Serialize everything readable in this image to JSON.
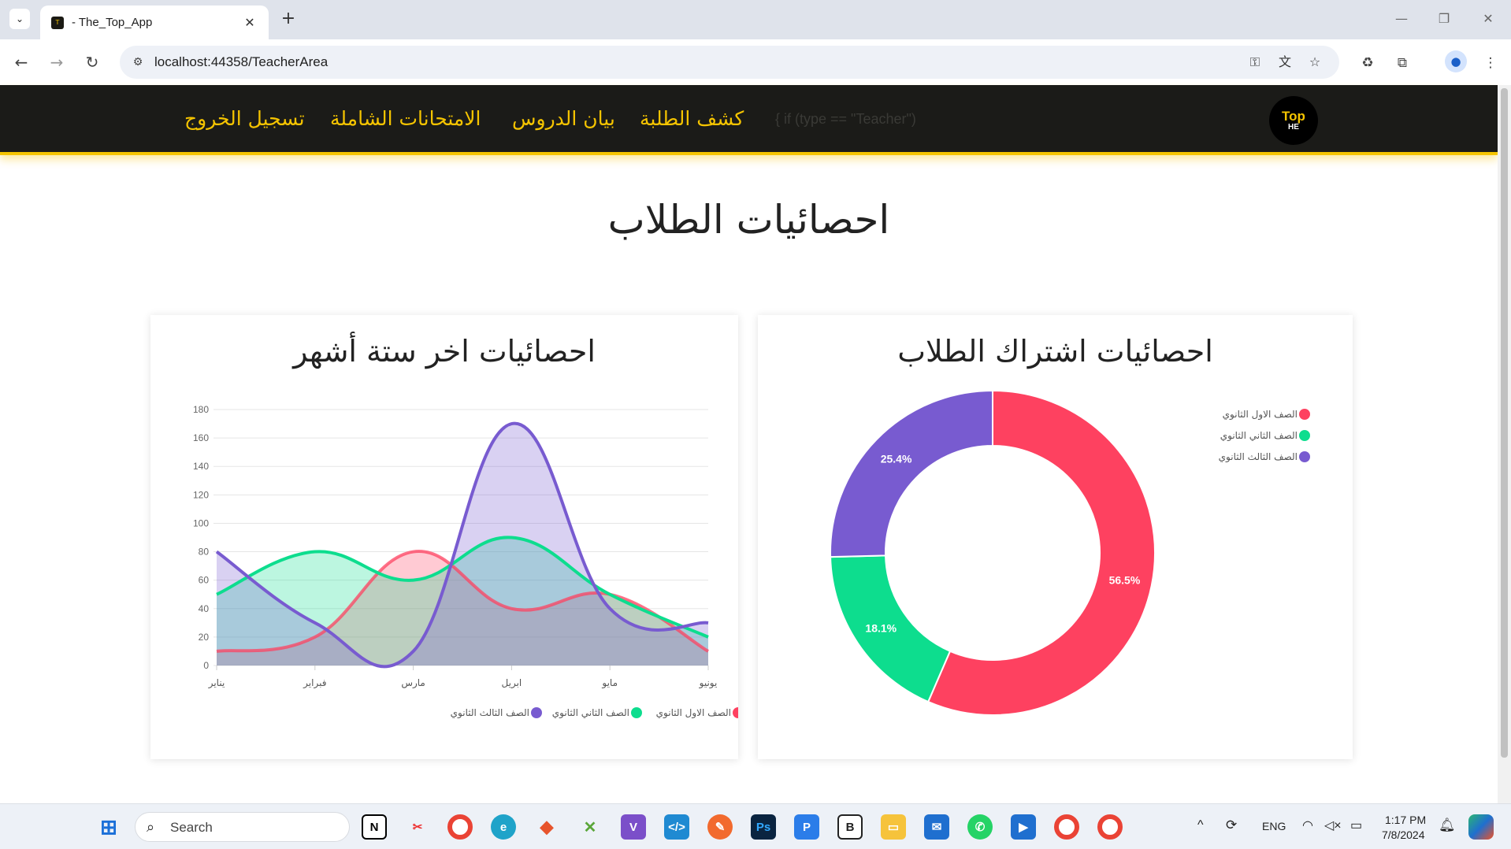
{
  "browser": {
    "tab_title": "- The_Top_App",
    "url": "localhost:44358/TeacherArea"
  },
  "site": {
    "nav": {
      "logout": "تسجيل الخروج",
      "exams": "الامتحانات الشاملة",
      "lessons": "بيان الدروس",
      "students": "كشف الطلبة",
      "dim_text": "{ if (type == \"Teacher\")"
    },
    "logo": {
      "top": "Top",
      "he": "HE"
    },
    "page_title": "احصائيات الطلاب"
  },
  "line_card": {
    "title": "احصائيات اخر ستة أشهر"
  },
  "donut_card": {
    "title": "احصائيات اشتراك الطلاب"
  },
  "colors": {
    "red": "#fe4160",
    "green": "#0ddd8e",
    "purple": "#785bd0",
    "nav_bg": "#1b1b18",
    "accent": "#f5c400"
  },
  "chart_data": [
    {
      "type": "line",
      "categories": [
        "يناير",
        "فبراير",
        "مارس",
        "ابريل",
        "مايو",
        "يونيو"
      ],
      "ylim": [
        0,
        180
      ],
      "yticks": [
        0,
        20,
        40,
        60,
        80,
        100,
        120,
        140,
        160,
        180
      ],
      "grid": true,
      "legend_position": "bottom",
      "series": [
        {
          "name": "الصف الاول الثانوي",
          "color": "#fe4160",
          "values": [
            10,
            20,
            80,
            40,
            50,
            10
          ]
        },
        {
          "name": "الصف الثاني الثانوي",
          "color": "#0ddd8e",
          "values": [
            50,
            80,
            60,
            90,
            50,
            20
          ]
        },
        {
          "name": "الصف الثالث الثانوي",
          "color": "#785bd0",
          "values": [
            80,
            30,
            10,
            170,
            40,
            30
          ]
        }
      ]
    },
    {
      "type": "pie",
      "subtype": "doughnut",
      "legend_position": "right",
      "slices": [
        {
          "name": "الصف الاول الثانوي",
          "color": "#fe4160",
          "value": 56.5,
          "label": "56.5%"
        },
        {
          "name": "الصف الثاني الثانوي",
          "color": "#0ddd8e",
          "value": 18.1,
          "label": "18.1%"
        },
        {
          "name": "الصف الثالث الثانوي",
          "color": "#785bd0",
          "value": 25.4,
          "label": "25.4%"
        }
      ]
    }
  ],
  "taskbar": {
    "search_placeholder": "Search",
    "lang": "ENG",
    "time": "1:17 PM",
    "date": "7/8/2024"
  }
}
